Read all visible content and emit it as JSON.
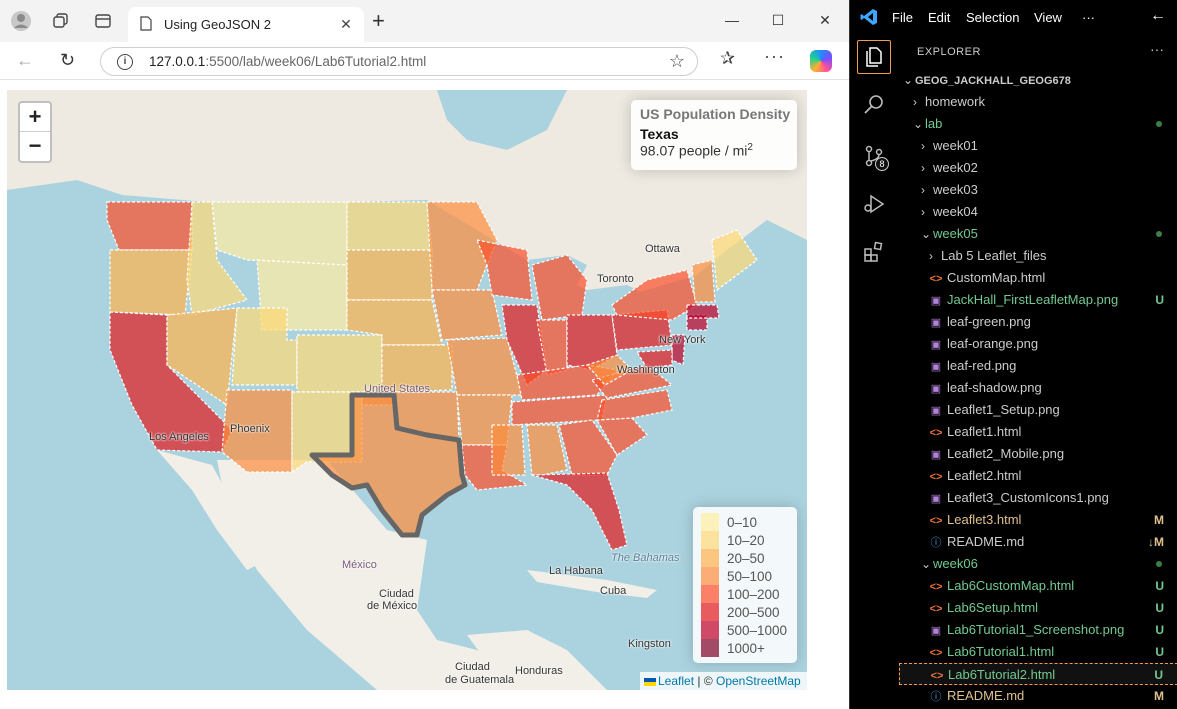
{
  "browser": {
    "tab_title": "Using GeoJSON 2",
    "url_host": "127.0.0.1",
    "url_rest": ":5500/lab/week06/Lab6Tutorial2.html"
  },
  "map": {
    "zoom_in": "+",
    "zoom_out": "−",
    "info": {
      "title": "US Population Density",
      "state": "Texas",
      "density_text": "98.07 people / mi",
      "density_sup": "2"
    },
    "legend": [
      {
        "label": "0–10",
        "color": "#FFEDA0"
      },
      {
        "label": "10–20",
        "color": "#FED976"
      },
      {
        "label": "20–50",
        "color": "#FEB24C"
      },
      {
        "label": "50–100",
        "color": "#FD8D3C"
      },
      {
        "label": "100–200",
        "color": "#FC4E2A"
      },
      {
        "label": "200–500",
        "color": "#E31A1C"
      },
      {
        "label": "500–1000",
        "color": "#BD0026"
      },
      {
        "label": "1000+",
        "color": "#800026"
      }
    ],
    "attribution": {
      "leaflet": "Leaflet",
      "sep": " | © ",
      "osm": "OpenStreetMap"
    },
    "labels": {
      "ottawa": "Ottawa",
      "toronto": "Toronto",
      "newyork": "New York",
      "washington": "Washington",
      "unitedstates": "United States",
      "losangeles": "Los Angeles",
      "phoenix": "Phoenix",
      "mexico": "México",
      "ciudadmexico1": "Ciudad",
      "ciudadmexico2": "de México",
      "lahabana": "La Habana",
      "cuba": "Cuba",
      "bahamas": "The Bahamas",
      "kingston": "Kingston",
      "honduras": "Honduras",
      "guatemala1": "Ciudad",
      "guatemala2": "de Guatemala"
    }
  },
  "vscode": {
    "menu": [
      "File",
      "Edit",
      "Selection",
      "View",
      "···"
    ],
    "explorer_title": "EXPLORER",
    "scm_count": "8",
    "tree": [
      {
        "label": "GEOG_JACKHALL_GEOG678",
        "depth": 0,
        "kind": "root",
        "twisty": "⌄"
      },
      {
        "label": "homework",
        "depth": 1,
        "kind": "folder",
        "twisty": "›"
      },
      {
        "label": "lab",
        "depth": 1,
        "kind": "folder",
        "twisty": "⌄",
        "dot": true,
        "color": "green"
      },
      {
        "label": "week01",
        "depth": 2,
        "kind": "folder",
        "twisty": "›"
      },
      {
        "label": "week02",
        "depth": 2,
        "kind": "folder",
        "twisty": "›"
      },
      {
        "label": "week03",
        "depth": 2,
        "kind": "folder",
        "twisty": "›"
      },
      {
        "label": "week04",
        "depth": 2,
        "kind": "folder",
        "twisty": "›"
      },
      {
        "label": "week05",
        "depth": 2,
        "kind": "folder",
        "twisty": "⌄",
        "dot": true,
        "color": "green"
      },
      {
        "label": "Lab 5 Leaflet_files",
        "depth": 3,
        "kind": "folder",
        "twisty": "›"
      },
      {
        "label": "CustomMap.html",
        "depth": 3,
        "kind": "html"
      },
      {
        "label": "JackHall_FirstLeafletMap.png",
        "depth": 3,
        "kind": "png",
        "status": "U",
        "color": "green"
      },
      {
        "label": "leaf-green.png",
        "depth": 3,
        "kind": "png"
      },
      {
        "label": "leaf-orange.png",
        "depth": 3,
        "kind": "png"
      },
      {
        "label": "leaf-red.png",
        "depth": 3,
        "kind": "png"
      },
      {
        "label": "leaf-shadow.png",
        "depth": 3,
        "kind": "png"
      },
      {
        "label": "Leaflet1_Setup.png",
        "depth": 3,
        "kind": "png"
      },
      {
        "label": "Leaflet1.html",
        "depth": 3,
        "kind": "html"
      },
      {
        "label": "Leaflet2_Mobile.png",
        "depth": 3,
        "kind": "png"
      },
      {
        "label": "Leaflet2.html",
        "depth": 3,
        "kind": "html"
      },
      {
        "label": "Leaflet3_CustomIcons1.png",
        "depth": 3,
        "kind": "png"
      },
      {
        "label": "Leaflet3.html",
        "depth": 3,
        "kind": "html",
        "status": "M",
        "color": "orange"
      },
      {
        "label": "README.md",
        "depth": 3,
        "kind": "md",
        "status": "↓M"
      },
      {
        "label": "week06",
        "depth": 2,
        "kind": "folder",
        "twisty": "⌄",
        "dot": true,
        "color": "green"
      },
      {
        "label": "Lab6CustomMap.html",
        "depth": 3,
        "kind": "html",
        "status": "U",
        "color": "green"
      },
      {
        "label": "Lab6Setup.html",
        "depth": 3,
        "kind": "html",
        "status": "U",
        "color": "green"
      },
      {
        "label": "Lab6Tutorial1_Screenshot.png",
        "depth": 3,
        "kind": "png",
        "status": "U",
        "color": "green"
      },
      {
        "label": "Lab6Tutorial1.html",
        "depth": 3,
        "kind": "html",
        "status": "U",
        "color": "green"
      },
      {
        "label": "Lab6Tutorial2.html",
        "depth": 3,
        "kind": "html",
        "status": "U",
        "color": "green",
        "selected": true
      },
      {
        "label": "README.md",
        "depth": 3,
        "kind": "md",
        "status": "M",
        "color": "orange"
      }
    ]
  }
}
